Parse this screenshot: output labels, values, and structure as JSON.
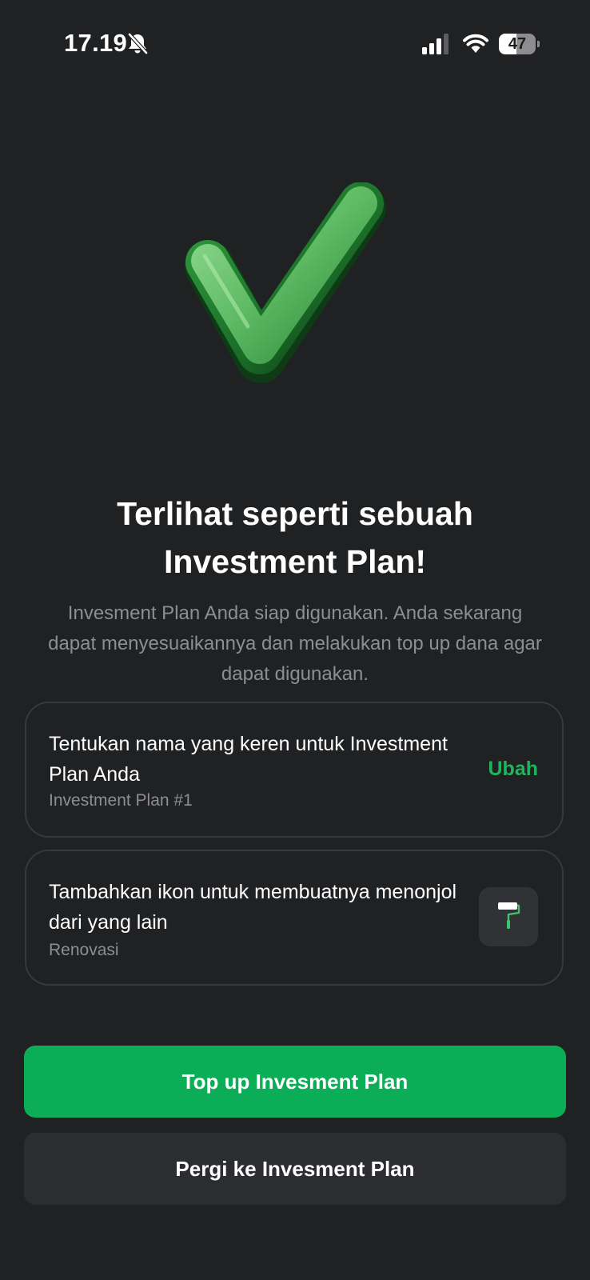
{
  "status_bar": {
    "time": "17.19",
    "battery": "47",
    "battery_level": 0.47
  },
  "headline": {
    "line1": "Terlihat seperti sebuah",
    "line2": "Investment Plan!"
  },
  "subtitle": "Invesment Plan Anda siap digunakan. Anda sekarang dapat menyesuaikannya dan melakukan top up dana agar dapat digunakan.",
  "name_card": {
    "title": "Tentukan nama yang keren untuk Investment Plan Anda",
    "value": "Investment Plan #1",
    "action": "Ubah"
  },
  "icon_card": {
    "title": "Tambahkan ikon untuk membuatnya menonjol dari yang lain",
    "value": "Renovasi",
    "icon": "paint-roller-icon"
  },
  "buttons": {
    "primary": "Top up Invesment Plan",
    "secondary": "Pergi ke Invesment Plan"
  },
  "colors": {
    "background": "#202123",
    "accent": "#0bad56",
    "link": "#22b35e"
  }
}
